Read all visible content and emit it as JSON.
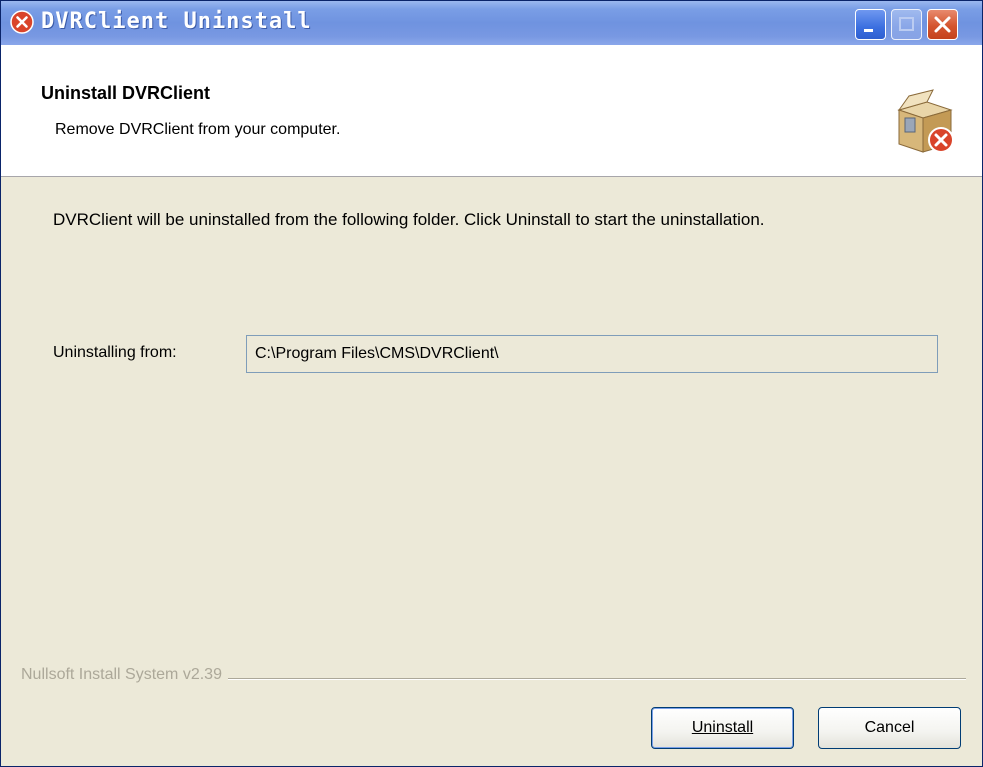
{
  "window": {
    "title": "DVRClient Uninstall",
    "colors": {
      "titlebar": "#7a9ee6",
      "close_button": "#d4552f",
      "dialog_bg": "#ece9d8"
    }
  },
  "header": {
    "title": "Uninstall DVRClient",
    "subtitle": "Remove DVRClient from your computer.",
    "icon": "uninstall-box-icon"
  },
  "body": {
    "description": "DVRClient will be uninstalled from the following folder. Click Uninstall to start the uninstallation.",
    "uninstall_from_label": "Uninstalling from:",
    "uninstall_from_value": "C:\\Program Files\\CMS\\DVRClient\\"
  },
  "footer": {
    "branding": "Nullsoft Install System v2.39",
    "uninstall_button": "Uninstall",
    "cancel_button": "Cancel"
  }
}
